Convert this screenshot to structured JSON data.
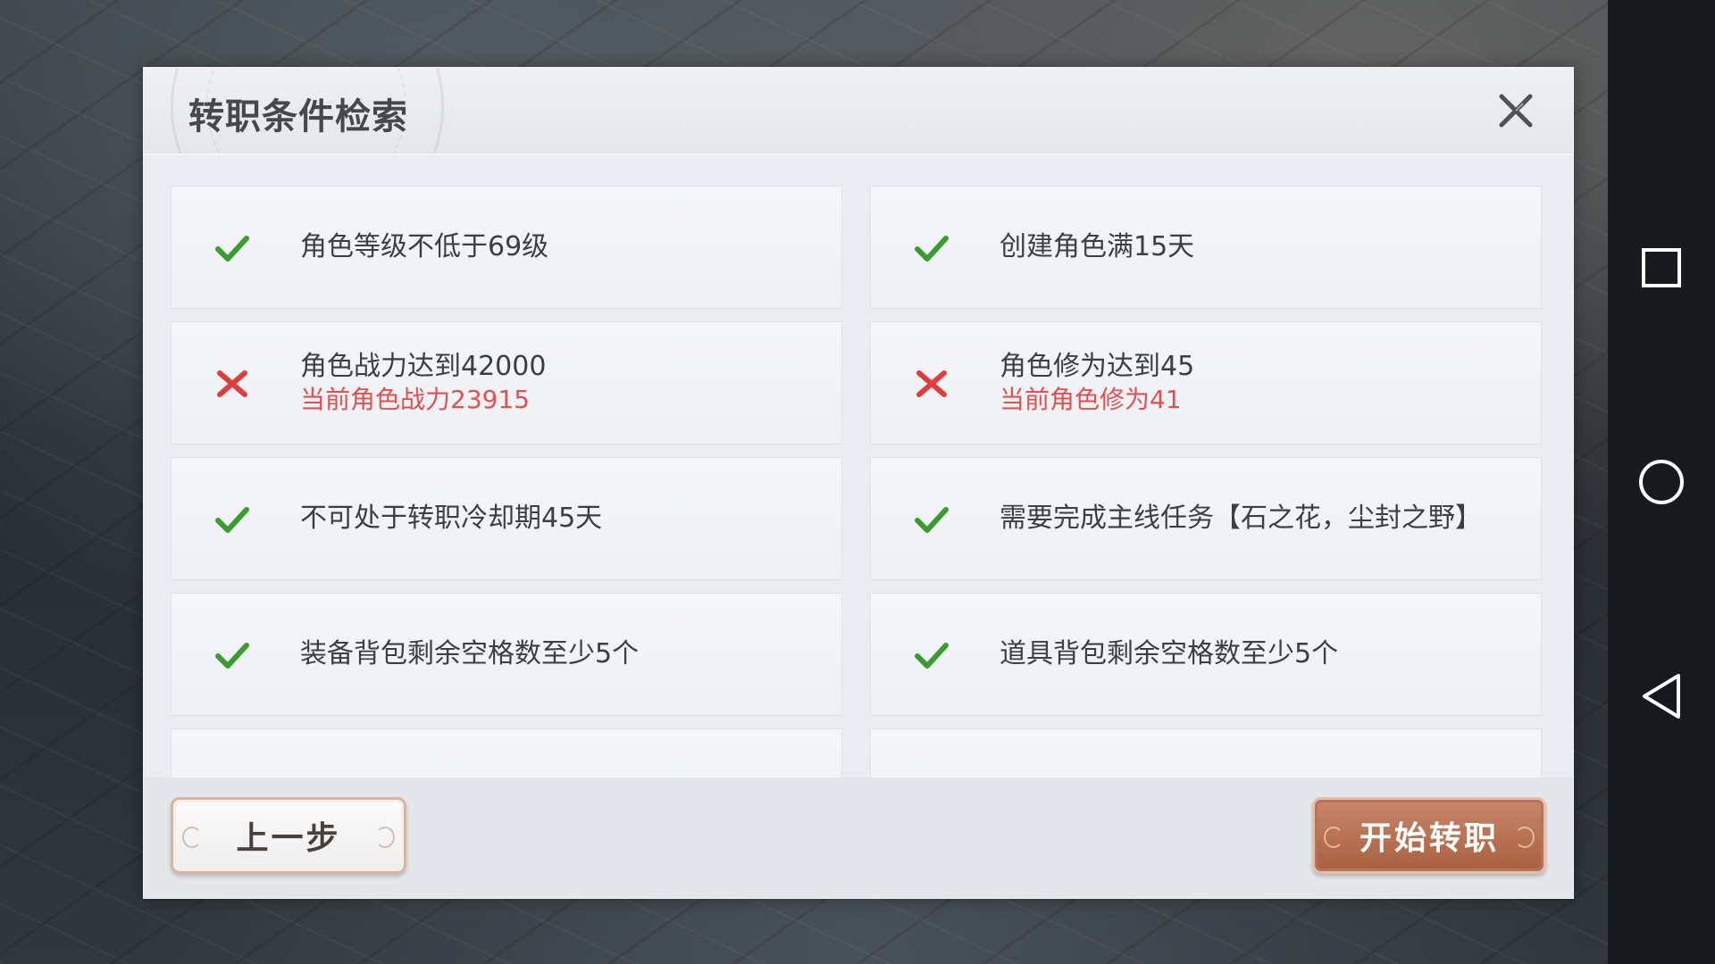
{
  "dialog": {
    "title": "转职条件检索"
  },
  "conditions": [
    {
      "status": "met",
      "text": "角色等级不低于69级",
      "sub": ""
    },
    {
      "status": "met",
      "text": "创建角色满15天",
      "sub": ""
    },
    {
      "status": "not-met",
      "text": "角色战力达到42000",
      "sub": "当前角色战力23915"
    },
    {
      "status": "not-met",
      "text": "角色修为达到45",
      "sub": "当前角色修为41"
    },
    {
      "status": "met",
      "text": "不可处于转职冷却期45天",
      "sub": ""
    },
    {
      "status": "met",
      "text": "需要完成主线任务【石之花，尘封之野】",
      "sub": ""
    },
    {
      "status": "met",
      "text": "装备背包剩余空格数至少5个",
      "sub": ""
    },
    {
      "status": "met",
      "text": "道具背包剩余空格数至少5个",
      "sub": ""
    }
  ],
  "footer": {
    "prev_label": "上一步",
    "start_label": "开始转职"
  },
  "colors": {
    "check": "#3a9b2e",
    "cross": "#e03c3c",
    "sub_text": "#e25151",
    "start_button": "#b66e4e"
  }
}
